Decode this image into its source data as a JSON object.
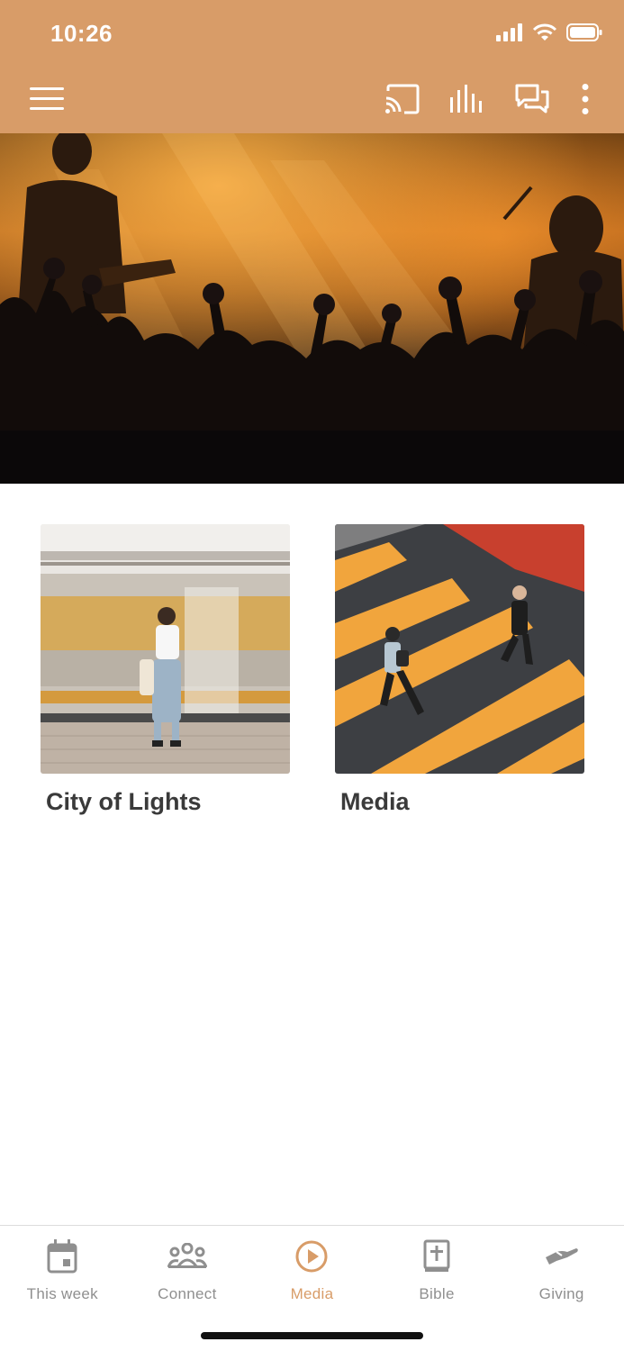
{
  "status_bar": {
    "time": "10:26"
  },
  "colors": {
    "accent": "#D89C68",
    "nav_inactive": "#8f8f8f",
    "title_text": "#3a3a3a"
  },
  "app_bar": {
    "menu_icon": "hamburger-icon",
    "actions": [
      {
        "icon": "cast-icon"
      },
      {
        "icon": "audio-bars-icon"
      },
      {
        "icon": "chat-icon"
      },
      {
        "icon": "more-vertical-icon"
      }
    ]
  },
  "hero": {
    "image": "concert-crowd-photo"
  },
  "cards": [
    {
      "title": "City of Lights",
      "image": "train-platform-photo"
    },
    {
      "title": "Media",
      "image": "crosswalk-photo"
    }
  ],
  "bottom_nav": {
    "active_index": 2,
    "items": [
      {
        "label": "This week",
        "icon": "calendar-icon"
      },
      {
        "label": "Connect",
        "icon": "group-icon"
      },
      {
        "label": "Media",
        "icon": "play-circle-icon"
      },
      {
        "label": "Bible",
        "icon": "bible-icon"
      },
      {
        "label": "Giving",
        "icon": "giving-hand-icon"
      }
    ]
  }
}
